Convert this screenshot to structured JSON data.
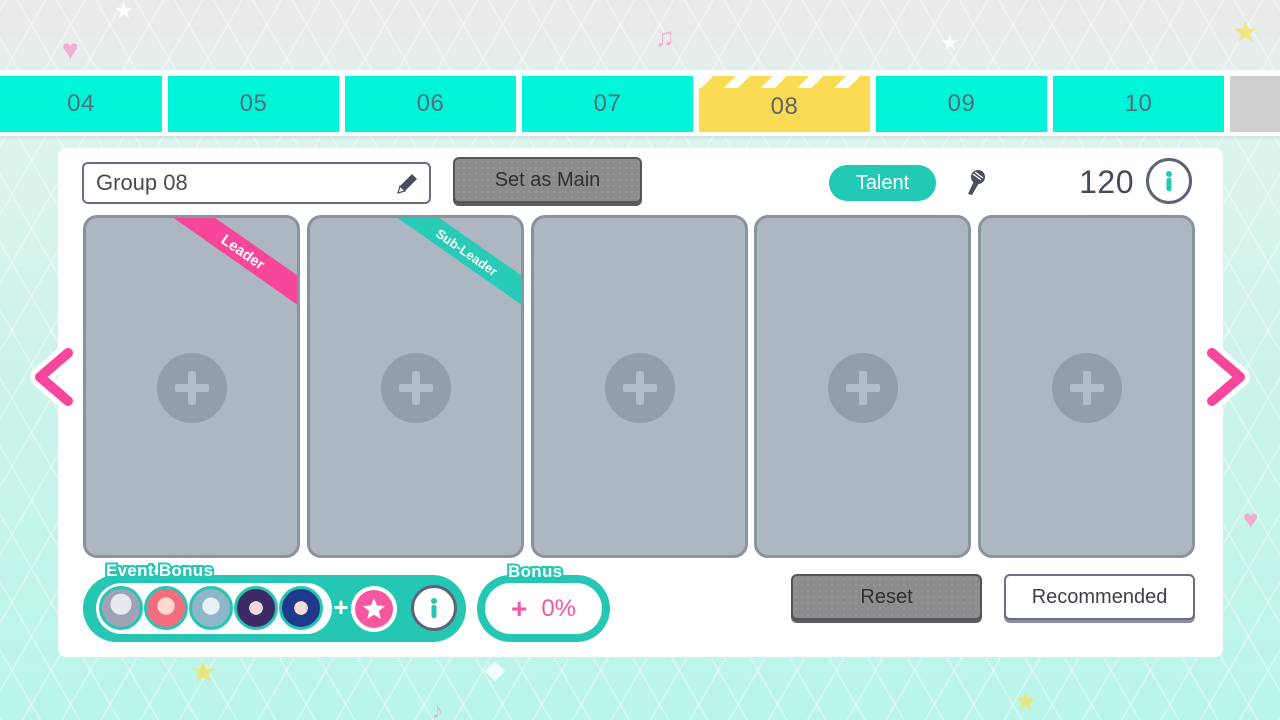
{
  "tabs": [
    {
      "label": "04",
      "active": false
    },
    {
      "label": "05",
      "active": false
    },
    {
      "label": "06",
      "active": false
    },
    {
      "label": "07",
      "active": false
    },
    {
      "label": "08",
      "active": true
    },
    {
      "label": "09",
      "active": false
    },
    {
      "label": "10",
      "active": false
    }
  ],
  "group": {
    "name_value": "Group 08",
    "set_main_label": "Set as Main",
    "talent_label": "Talent",
    "talent_value": "120"
  },
  "slots": [
    {
      "ribbon": "Leader"
    },
    {
      "ribbon": "Sub-Leader"
    },
    {
      "ribbon": ""
    },
    {
      "ribbon": ""
    },
    {
      "ribbon": ""
    }
  ],
  "event_bonus": {
    "label": "Event Bonus",
    "avatars": [
      "character-avatar-1",
      "character-avatar-2",
      "character-avatar-3",
      "character-avatar-4",
      "character-avatar-5"
    ]
  },
  "bonus": {
    "label": "Bonus",
    "sign": "+",
    "value": "0%"
  },
  "actions": {
    "reset_label": "Reset",
    "recommended_label": "Recommended"
  },
  "colors": {
    "tab": "#00f5d8",
    "tab_active": "#f9dc54",
    "accent": "#25c6b3",
    "pink": "#f8479b",
    "slot": "#adb7c2"
  },
  "icons": {
    "edit": "pencil-icon",
    "talent": "microphone-icon",
    "info": "info-icon",
    "prev": "chevron-left-icon",
    "next": "chevron-right-icon",
    "add": "plus-icon",
    "star": "star-icon"
  }
}
